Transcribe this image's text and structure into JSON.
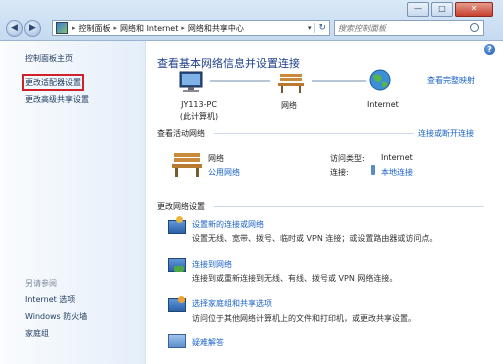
{
  "window": {
    "minimize_label": "—",
    "maximize_label": "□",
    "close_label": "✕"
  },
  "nav": {
    "back_glyph": "◀",
    "forward_glyph": "▶",
    "refresh_glyph": "↻"
  },
  "address": {
    "segments": [
      "控制面板",
      "网络和 Internet",
      "网络和共享中心"
    ],
    "separator": "▸"
  },
  "search": {
    "placeholder": "搜索控制面板"
  },
  "sidebar": {
    "home": "控制面板主页",
    "items": [
      "更改适配器设置",
      "更改高级共享设置"
    ],
    "see_also_heading": "另请参阅",
    "see_also": [
      "Internet 选项",
      "Windows 防火墙",
      "家庭组"
    ]
  },
  "main": {
    "title": "查看基本网络信息并设置连接",
    "view_full_map": "查看完整映射",
    "map": {
      "computer_name": "JY113-PC",
      "computer_sub": "(此计算机)",
      "network": "网络",
      "internet": "Internet"
    },
    "active_heading": "查看活动网络",
    "connect_disconnect": "连接或断开连接",
    "active": {
      "name": "网络",
      "type": "公用网络",
      "access_label": "访问类型:",
      "access_value": "Internet",
      "connection_label": "连接:",
      "connection_value": "本地连接"
    },
    "change_heading": "更改网络设置",
    "tasks": [
      {
        "title": "设置新的连接或网络",
        "desc": "设置无线、宽带、拨号、临时或 VPN 连接；或设置路由器或访问点。"
      },
      {
        "title": "连接到网络",
        "desc": "连接到或重新连接到无线、有线、拨号或 VPN 网络连接。"
      },
      {
        "title": "选择家庭组和共享选项",
        "desc": "访问位于其他网络计算机上的文件和打印机，或更改共享设置。"
      },
      {
        "title": "疑难解答",
        "desc": ""
      }
    ],
    "help_glyph": "?"
  }
}
